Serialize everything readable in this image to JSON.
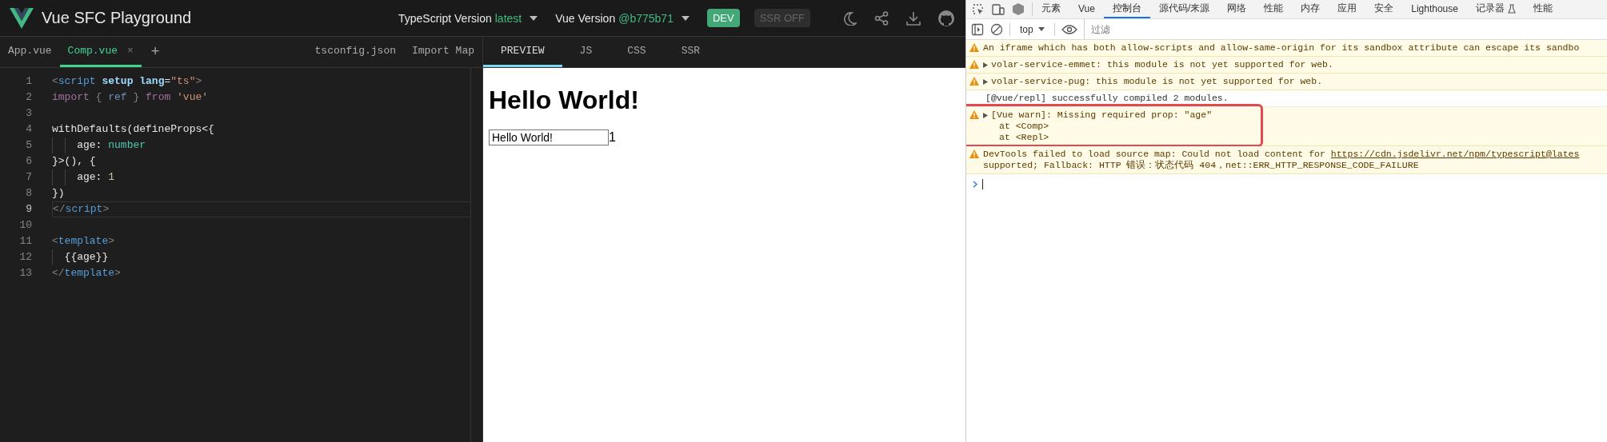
{
  "header": {
    "title": "Vue SFC Playground",
    "ts_version": {
      "label": "TypeScript Version",
      "value": "latest"
    },
    "vue_version": {
      "label": "Vue Version",
      "value": "@b775b71"
    },
    "toggles": [
      {
        "label": "DEV",
        "on": true
      },
      {
        "label": "SSR OFF",
        "on": false
      }
    ]
  },
  "editor": {
    "tabs": [
      {
        "label": "App.vue",
        "selected": false
      },
      {
        "label": "Comp.vue",
        "selected": true,
        "close": "×"
      }
    ],
    "add": "+",
    "extra_tabs": [
      "tsconfig.json",
      "Import Map"
    ],
    "lines": [
      {
        "number": "1",
        "current": false,
        "tokens": [
          {
            "kind": "punct",
            "text": "<"
          },
          {
            "kind": "tag",
            "text": "script"
          },
          {
            "kind": "attr",
            "text": " setup"
          },
          {
            "kind": "attr",
            "text": " lang"
          },
          {
            "kind": "plain",
            "text": "="
          },
          {
            "kind": "string",
            "text": "\"ts\""
          },
          {
            "kind": "punct",
            "text": ">"
          }
        ]
      },
      {
        "number": "2",
        "current": false,
        "tokens": [
          {
            "kind": "keyword",
            "text": "import"
          },
          {
            "kind": "punct",
            "text": " { "
          },
          {
            "kind": "var",
            "text": "ref"
          },
          {
            "kind": "punct",
            "text": " } "
          },
          {
            "kind": "keyword",
            "text": "from"
          },
          {
            "kind": "string",
            "text": " 'vue'"
          }
        ]
      },
      {
        "number": "3",
        "current": false
      },
      {
        "number": "4",
        "current": false,
        "tokens": [
          {
            "kind": "plain",
            "text": "withDefaults(defineProps<{"
          }
        ]
      },
      {
        "number": "5",
        "current": false,
        "tokens": [
          {
            "kind": "plain",
            "text": "    age: "
          },
          {
            "kind": "type",
            "text": "number"
          }
        ]
      },
      {
        "number": "6",
        "current": false,
        "tokens": [
          {
            "kind": "plain",
            "text": "}>(), {"
          }
        ]
      },
      {
        "number": "7",
        "current": false,
        "tokens": [
          {
            "kind": "plain",
            "text": "    age: "
          },
          {
            "kind": "number",
            "text": "1"
          }
        ]
      },
      {
        "number": "8",
        "current": false,
        "tokens": [
          {
            "kind": "plain",
            "text": "})"
          }
        ]
      },
      {
        "number": "9",
        "current": true,
        "tokens": [
          {
            "kind": "punct",
            "text": "</"
          },
          {
            "kind": "tag",
            "text": "script"
          },
          {
            "kind": "punct",
            "text": ">"
          }
        ]
      },
      {
        "number": "10",
        "current": false
      },
      {
        "number": "11",
        "current": false,
        "tokens": [
          {
            "kind": "punct",
            "text": "<"
          },
          {
            "kind": "tag",
            "text": "template"
          },
          {
            "kind": "punct",
            "text": ">"
          }
        ]
      },
      {
        "number": "12",
        "current": false,
        "tokens": [
          {
            "kind": "plain",
            "text": "  {{age}}"
          }
        ]
      },
      {
        "number": "13",
        "current": false,
        "tokens": [
          {
            "kind": "punct",
            "text": "</"
          },
          {
            "kind": "tag",
            "text": "template"
          },
          {
            "kind": "punct",
            "text": ">"
          }
        ]
      }
    ]
  },
  "preview": {
    "tabs": [
      {
        "label": "PREVIEW",
        "selected": true
      },
      {
        "label": "JS",
        "selected": false
      },
      {
        "label": "CSS",
        "selected": false
      },
      {
        "label": "SSR",
        "selected": false
      }
    ],
    "heading": "Hello World!",
    "input_value": "Hello World!",
    "output": "1"
  },
  "devtools": {
    "tabs": [
      {
        "label": "元素",
        "selected": false
      },
      {
        "label": "Vue",
        "selected": false
      },
      {
        "label": "控制台",
        "selected": true
      },
      {
        "label": "源代码/来源",
        "selected": false
      },
      {
        "label": "网络",
        "selected": false
      },
      {
        "label": "性能",
        "selected": false
      },
      {
        "label": "内存",
        "selected": false
      },
      {
        "label": "应用",
        "selected": false
      },
      {
        "label": "安全",
        "selected": false
      },
      {
        "label": "Lighthouse",
        "selected": false
      },
      {
        "label": "记录器",
        "selected": false
      },
      {
        "label": "性能",
        "selected": false
      }
    ],
    "context": "top",
    "filter": {
      "placeholder": "过滤"
    },
    "messages": [
      {
        "kind": "warning",
        "expandable": false,
        "highlighted": false,
        "text": "An iframe which has both allow-scripts and allow-same-origin for its sandbox attribute can escape its sandbo"
      },
      {
        "kind": "warning",
        "expandable": true,
        "highlighted": false,
        "text": "volar-service-emmet: this module is not yet supported for web."
      },
      {
        "kind": "warning",
        "expandable": true,
        "highlighted": false,
        "text": "volar-service-pug: this module is not yet supported for web."
      },
      {
        "kind": "info",
        "expandable": false,
        "highlighted": false,
        "text": "[@vue/repl] successfully compiled 2 modules."
      },
      {
        "kind": "warning",
        "expandable": true,
        "highlighted": true,
        "text": "[Vue warn]: Missing required prop: \"age\"",
        "more": [
          "at <Comp>",
          "at <Repl>"
        ]
      },
      {
        "kind": "warning",
        "expandable": false,
        "highlighted": false,
        "text": "DevTools failed to load source map: Could not load content for ",
        "link": "https://cdn.jsdelivr.net/npm/typescript@lates",
        "more": [
          "supported; Fallback: HTTP 错误：状态代码 404，net::ERR_HTTP_RESPONSE_CODE_FAILURE"
        ]
      }
    ]
  }
}
